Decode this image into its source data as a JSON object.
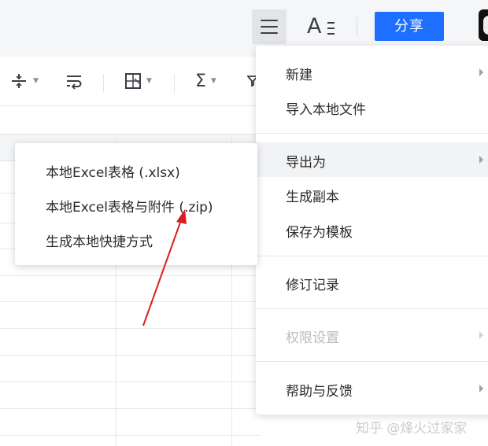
{
  "header": {
    "share_label": "分享"
  },
  "menu": {
    "items": [
      {
        "label": "新建"
      },
      {
        "label": "导入本地文件"
      },
      {
        "label": "导出为"
      },
      {
        "label": "生成副本"
      },
      {
        "label": "保存为模板"
      },
      {
        "label": "修订记录"
      },
      {
        "label": "权限设置"
      },
      {
        "label": "帮助与反馈"
      }
    ]
  },
  "submenu": {
    "items": [
      {
        "label": "本地Excel表格 (.xlsx)"
      },
      {
        "label": "本地Excel表格与附件 (.zip)"
      },
      {
        "label": "生成本地快捷方式"
      }
    ]
  },
  "watermark": "知乎 @烽火过家家",
  "colors": {
    "accent": "#1e6fff",
    "annotation_arrow": "#d81e1e"
  }
}
